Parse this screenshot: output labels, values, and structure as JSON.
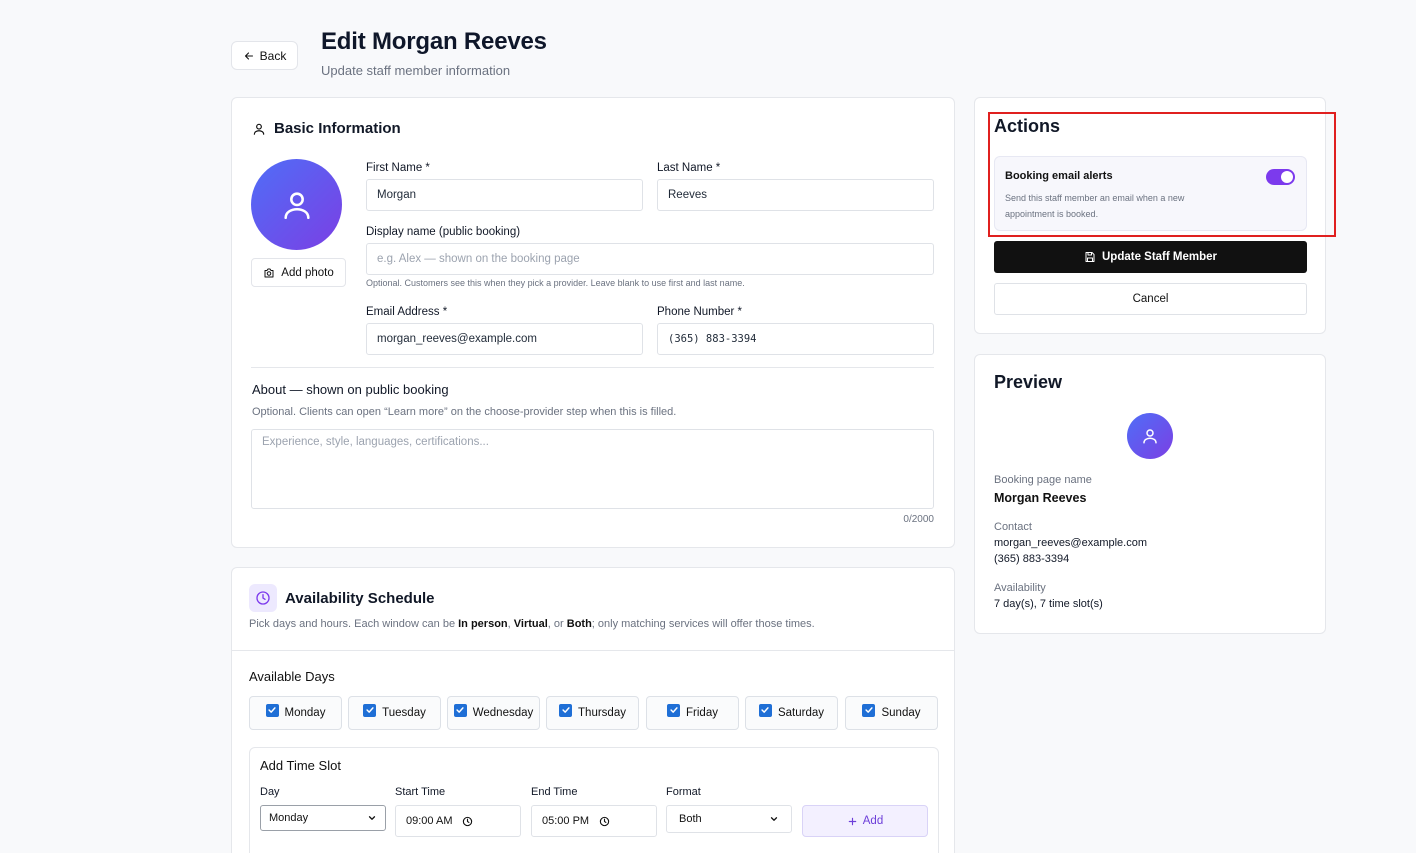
{
  "header": {
    "back_label": "Back",
    "title": "Edit Morgan Reeves",
    "subtitle": "Update staff member information"
  },
  "basic": {
    "title": "Basic Information",
    "add_photo_label": "Add photo",
    "first_name": {
      "label": "First Name *",
      "value": "Morgan"
    },
    "last_name": {
      "label": "Last Name *",
      "value": "Reeves"
    },
    "display_name": {
      "label": "Display name (public booking)",
      "placeholder": "e.g. Alex — shown on the booking page",
      "hint": "Optional. Customers see this when they pick a provider. Leave blank to use first and last name."
    },
    "email": {
      "label": "Email Address *",
      "value": "morgan_reeves@example.com"
    },
    "phone": {
      "label": "Phone Number *",
      "value": "(365) 883-3394"
    },
    "about": {
      "label": "About — shown on public booking",
      "hint": "Optional. Clients can open “Learn more” on the choose-provider step when this is filled.",
      "placeholder": "Experience, style, languages, certifications...",
      "counter": "0/2000"
    }
  },
  "availability": {
    "title": "Availability Schedule",
    "desc_prefix": "Pick days and hours. Each window can be ",
    "desc_in_person": "In person",
    "desc_sep1": ", ",
    "desc_virtual": "Virtual",
    "desc_sep2": ", or ",
    "desc_both": "Both",
    "desc_suffix": "; only matching services will offer those times.",
    "days_label": "Available Days",
    "days": [
      "Monday",
      "Tuesday",
      "Wednesday",
      "Thursday",
      "Friday",
      "Saturday",
      "Sunday"
    ],
    "slot": {
      "title": "Add Time Slot",
      "day_label": "Day",
      "day_value": "Monday",
      "start_label": "Start Time",
      "start_value": "09:00 AM",
      "end_label": "End Time",
      "end_value": "05:00 PM",
      "format_label": "Format",
      "format_value": "Both",
      "add_label": "Add"
    }
  },
  "actions": {
    "title": "Actions",
    "alert_title": "Booking email alerts",
    "alert_desc": "Send this staff member an email when a new appointment is booked.",
    "alert_enabled": true,
    "update_label": "Update Staff Member",
    "cancel_label": "Cancel"
  },
  "preview": {
    "title": "Preview",
    "booking_name_label": "Booking page name",
    "booking_name": "Morgan Reeves",
    "contact_label": "Contact",
    "contact_email": "morgan_reeves@example.com",
    "contact_phone": "(365) 883-3394",
    "availability_label": "Availability",
    "availability_value": "7 day(s), 7 time slot(s)"
  },
  "colors": {
    "accent": "#7c3aed",
    "highlight": "#e0201f",
    "check": "#1f6fd6"
  }
}
